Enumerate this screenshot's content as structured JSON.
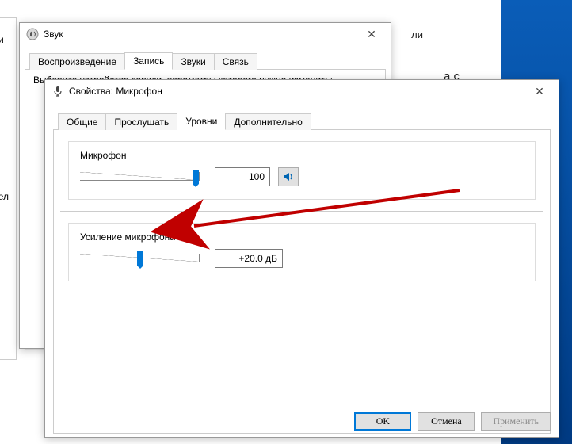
{
  "desktop": {},
  "background_window": {
    "title": "Звук",
    "tabs": [
      "Воспроизведение",
      "Запись",
      "Звуки",
      "Связь"
    ],
    "active_tab": 1,
    "hint": "Выберите устройство записи, параметры которого нужно изменить:"
  },
  "properties_window": {
    "title": "Свойства: Микрофон",
    "tabs": [
      "Общие",
      "Прослушать",
      "Уровни",
      "Дополнительно"
    ],
    "active_tab": 2,
    "sections": {
      "mic": {
        "label": "Микрофон",
        "value": "100",
        "slider_pos_pct": 95,
        "mute_icon": "speaker"
      },
      "boost": {
        "label": "Усиление микрофона",
        "value": "+20.0 дБ",
        "slider_pos_pct": 50
      }
    },
    "buttons": {
      "ok": "OK",
      "cancel": "Отмена",
      "apply": "Применить"
    }
  }
}
